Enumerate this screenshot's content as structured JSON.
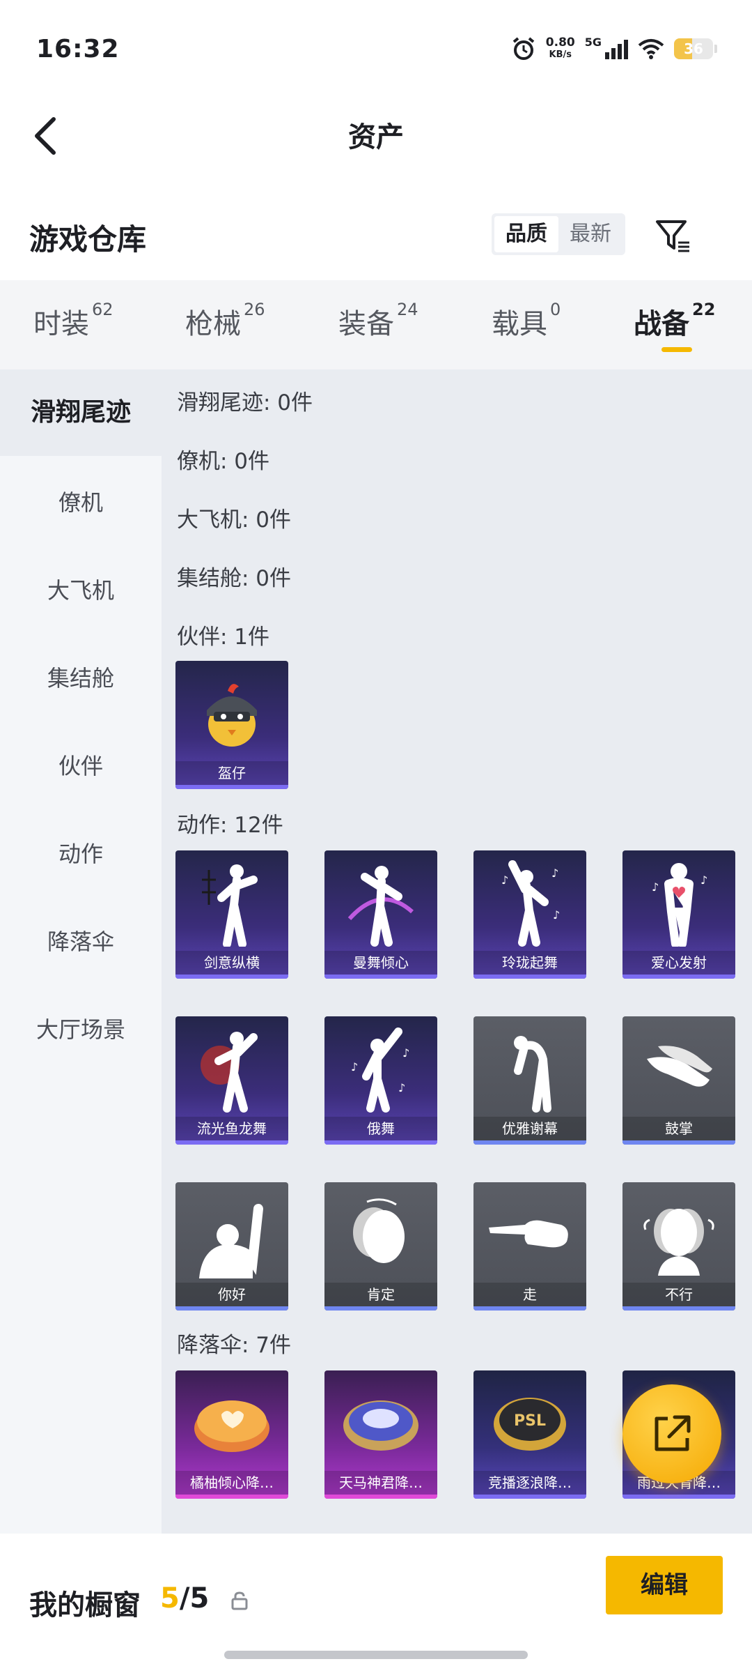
{
  "status_bar": {
    "time": "16:32",
    "speed": "0.80",
    "speed_unit": "KB/s",
    "network": "5G",
    "battery": "36"
  },
  "header": {
    "title": "资产"
  },
  "section": {
    "title": "游戏仓库",
    "sort_options": [
      "品质",
      "最新"
    ],
    "active_sort": "品质"
  },
  "tabs": [
    {
      "label": "时装",
      "count": "62"
    },
    {
      "label": "枪械",
      "count": "26"
    },
    {
      "label": "装备",
      "count": "24"
    },
    {
      "label": "载具",
      "count": "0"
    },
    {
      "label": "战备",
      "count": "22",
      "active": true
    }
  ],
  "sidebar": {
    "items": [
      "滑翔尾迹",
      "僚机",
      "大飞机",
      "集结舱",
      "伙伴",
      "动作",
      "降落伞",
      "大厅场景"
    ],
    "active": "滑翔尾迹"
  },
  "categories": {
    "glide": "滑翔尾迹: 0件",
    "wingman": "僚机: 0件",
    "plane": "大飞机: 0件",
    "pod": "集结舱: 0件",
    "partner": "伙伴: 1件",
    "emote": "动作: 12件",
    "parachute": "降落伞: 7件"
  },
  "partner_items": [
    {
      "name": "盔仔",
      "icon": "chick-helmet-icon"
    }
  ],
  "emote_items": [
    {
      "name": "剑意纵横",
      "icon": "dance-pose-icon"
    },
    {
      "name": "曼舞倾心",
      "icon": "dance-pose-icon"
    },
    {
      "name": "玲珑起舞",
      "icon": "dance-pose-icon"
    },
    {
      "name": "爱心发射",
      "icon": "heart-pose-icon"
    },
    {
      "name": "流光鱼龙舞",
      "icon": "dance-pose-icon"
    },
    {
      "name": "俄舞",
      "icon": "dance-pose-icon"
    },
    {
      "name": "优雅谢幕",
      "icon": "bow-pose-icon"
    },
    {
      "name": "鼓掌",
      "icon": "clap-hands-icon"
    },
    {
      "name": "你好",
      "icon": "wave-hand-icon"
    },
    {
      "name": "肯定",
      "icon": "nod-head-icon"
    },
    {
      "name": "走",
      "icon": "point-hand-icon"
    },
    {
      "name": "不行",
      "icon": "shake-head-icon"
    }
  ],
  "parachute_items": [
    {
      "name": "橘柚倾心降…",
      "icon": "parachute-icon"
    },
    {
      "name": "天马神君降…",
      "icon": "parachute-icon"
    },
    {
      "name": "竞播逐浪降…",
      "icon": "parachute-icon"
    },
    {
      "name": "雨过天青降…",
      "icon": "parachute-icon"
    }
  ],
  "bottom_bar": {
    "label": "我的橱窗",
    "current": "5",
    "total": "/5",
    "edit_label": "编辑"
  },
  "colors": {
    "accent": "#f5b800",
    "background": "#e9ecf1",
    "sidebar": "#f4f6f9"
  }
}
